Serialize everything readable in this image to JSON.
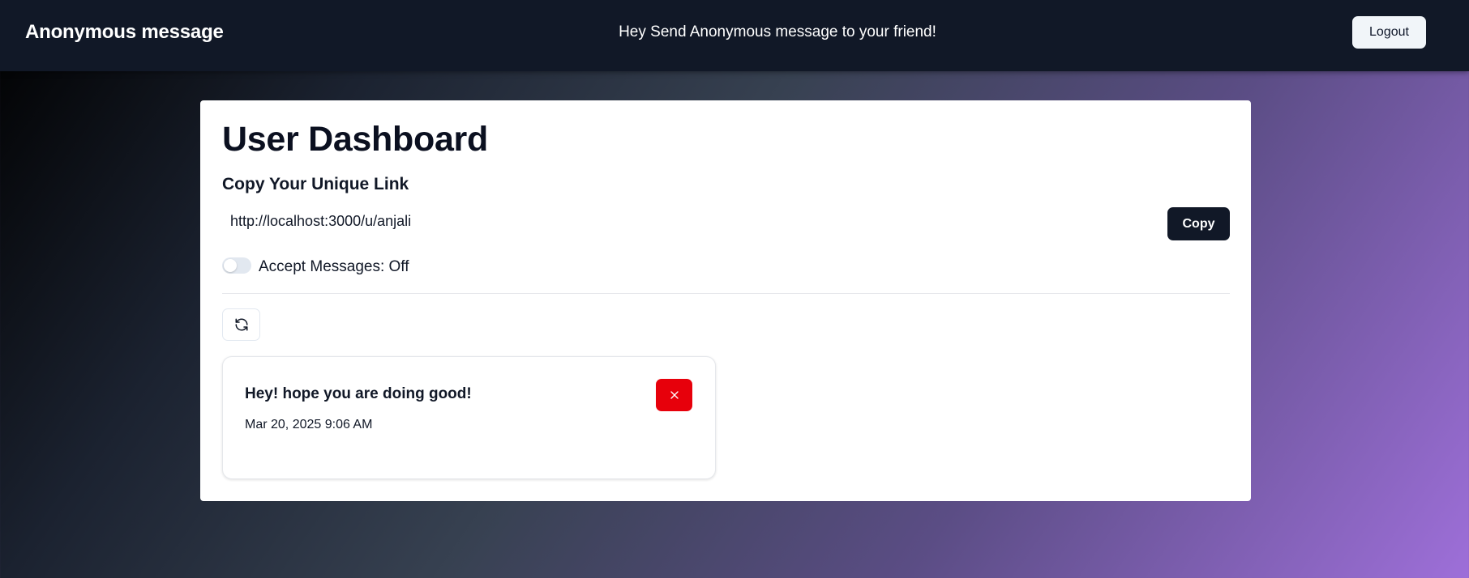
{
  "header": {
    "brand": "Anonymous message",
    "tagline": "Hey Send Anonymous message to your friend!",
    "logout_label": "Logout"
  },
  "dashboard": {
    "title": "User Dashboard",
    "link_section_title": "Copy Your Unique Link",
    "unique_link": "http://localhost:3000/u/anjali",
    "copy_label": "Copy",
    "accept_messages_label": "Accept Messages: Off",
    "accept_messages_on": false
  },
  "messages": [
    {
      "content": "Hey! hope you are doing good!",
      "date": "Mar 20, 2025 9:06 AM"
    }
  ],
  "icons": {
    "refresh": "refresh-icon",
    "delete": "close-icon"
  },
  "colors": {
    "navbar": "#111827",
    "primary_button": "#111827",
    "danger": "#e7000b",
    "gradient_start": "#000000",
    "gradient_end": "#9e6fd9"
  }
}
